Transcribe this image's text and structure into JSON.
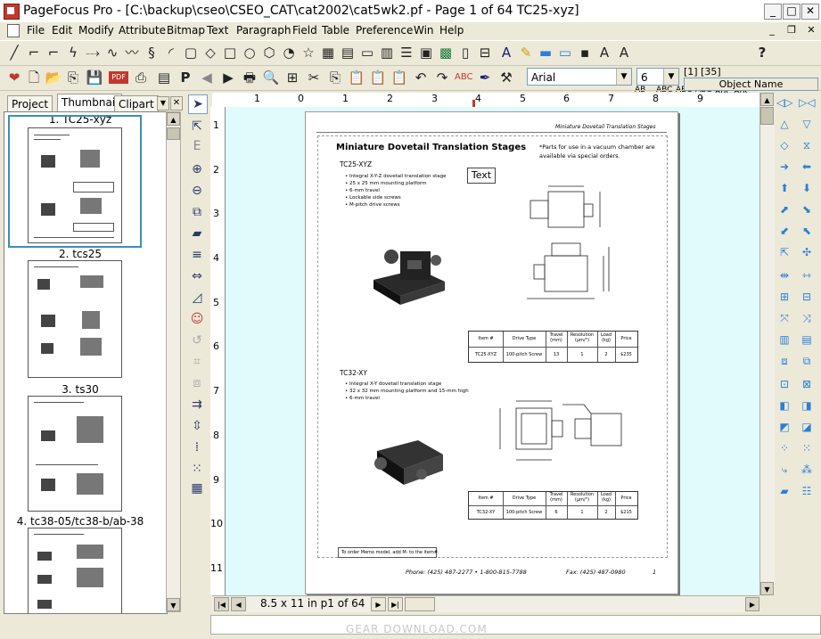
{
  "window": {
    "title": "PageFocus Pro - [C:\\backup\\cseo\\CSEO_CAT\\cat2002\\cat5wk2.pf - Page 1 of 64 TC25-xyz]",
    "controls": [
      "_",
      "□",
      "✕"
    ],
    "mdi_controls": [
      "_",
      "❐",
      "✕"
    ]
  },
  "menu": [
    "File",
    "Edit",
    "Modify",
    "Attribute",
    "Bitmap",
    "Text",
    "Paragraph",
    "Field",
    "Table",
    "Preference",
    "Win",
    "Help"
  ],
  "toolbar2": {
    "font_name": "Arial",
    "font_size": "6",
    "selection_info": "[1] [35]",
    "object_name_label": "Object Name"
  },
  "left_panel": {
    "tabs": [
      "Project",
      "Thumbnail",
      "Clipart"
    ],
    "active_tab": "Thumbnail",
    "thumbnails": [
      "1. TC25-xyz",
      "2. tcs25",
      "3. ts30",
      "4. tc38-05/tc38-b/ab-38"
    ]
  },
  "ruler": {
    "h_numbers": [
      "1",
      "0",
      "1",
      "2",
      "3",
      "4",
      "5",
      "6",
      "7",
      "8",
      "9"
    ],
    "v_numbers": [
      "1",
      "2",
      "3",
      "4",
      "5",
      "6",
      "7",
      "8",
      "9",
      "10",
      "11"
    ]
  },
  "document": {
    "header_right": "Miniature Dovetail Translation Stages",
    "heading": "Miniature Dovetail Translation Stages",
    "note": "*Parts for use in a vacuum chamber are available via special orders.",
    "text_box": "Text",
    "section1": {
      "title": "TC25-XYZ",
      "bullets": [
        "Integral X-Y-Z dovetail translation stage",
        "25 x 25 mm mounting platform",
        "6-mm travel",
        "Lockable side screws",
        "M-pitch drive screws"
      ],
      "table_headers": [
        "Item #",
        "Drive Type",
        "Travel (mm)",
        "Resolution (µm/°)",
        "Load (kg)",
        "Price"
      ],
      "table_row": [
        "TC25-XYZ",
        "100-pitch Screw",
        "13",
        "1",
        "2",
        "$235"
      ]
    },
    "section2": {
      "title": "TC32-XY",
      "bullets": [
        "Integral X-Y dovetail translation stage",
        "32 x 32 mm mounting platform and 15-mm high",
        "6-mm travel"
      ],
      "table_headers": [
        "Item #",
        "Drive Type",
        "Travel (mm)",
        "Resolution (µm/°)",
        "Load (kg)",
        "Price"
      ],
      "table_row": [
        "TC32-XY",
        "100-pitch Screw",
        "6",
        "1",
        "2",
        "$215"
      ]
    },
    "order_note": "To order Memo model, add M- to the item#.",
    "footer_phone": "Phone: (425) 487-2277  •  1-800-815-7788",
    "footer_fax": "Fax: (425) 487-0980",
    "page_number": "1"
  },
  "bottom": {
    "page_size": "8.5 x 11 in",
    "page_position": "p1 of 64"
  },
  "watermark": "GEAR DOWNLOAD.COM"
}
